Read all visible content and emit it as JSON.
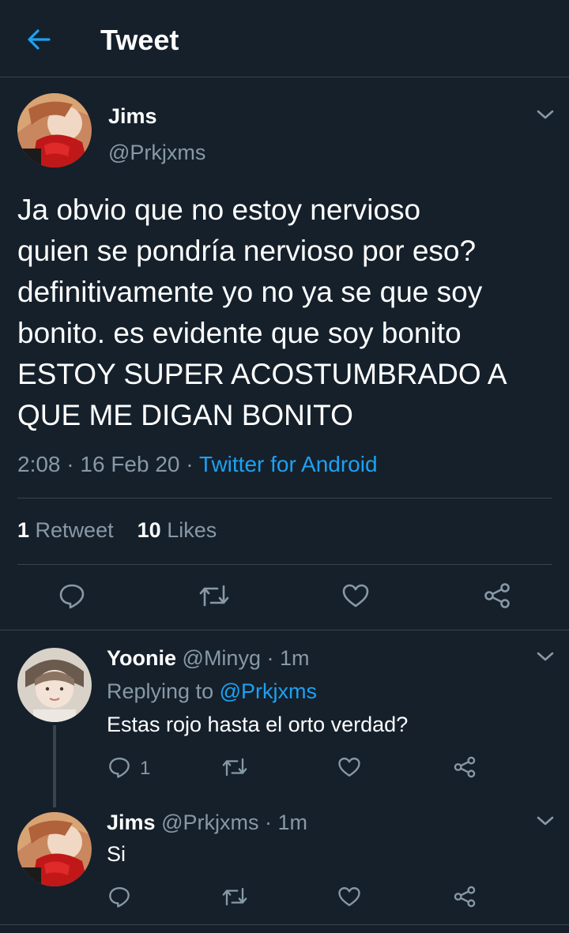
{
  "header": {
    "title": "Tweet"
  },
  "tweet": {
    "author_name": "Jims",
    "author_handle": "@Prkjxms",
    "lines": [
      "Ja obvio que no estoy nervioso",
      "quien se pondría nervioso por eso?",
      "definitivamente yo no ya se que soy",
      "bonito. es evidente que soy bonito",
      "ESTOY SUPER ACOSTUMBRADO A",
      "QUE ME DIGAN BONITO"
    ],
    "time": "2:08",
    "date": "16 Feb 20",
    "source": "Twitter for Android",
    "retweets_count": "1",
    "retweets_label": "Retweet",
    "likes_count": "10",
    "likes_label": "Likes"
  },
  "replies": [
    {
      "name": "Yoonie",
      "handle": "@Minyg",
      "time": "1m",
      "replying_prefix": "Replying to",
      "replying_to": "@Prkjxms",
      "text": "Estas rojo hasta el orto verdad?",
      "reply_count": "1"
    },
    {
      "name": "Jims",
      "handle": "@Prkjxms",
      "time": "1m",
      "text": "Si"
    }
  ],
  "separator": "·",
  "colors": {
    "background": "#15202b",
    "accent": "#1da1f2",
    "muted": "#8899a6",
    "divider": "#38444d"
  },
  "icons": [
    "back-arrow-icon",
    "chevron-down-icon",
    "reply-icon",
    "retweet-icon",
    "like-icon",
    "share-icon"
  ]
}
